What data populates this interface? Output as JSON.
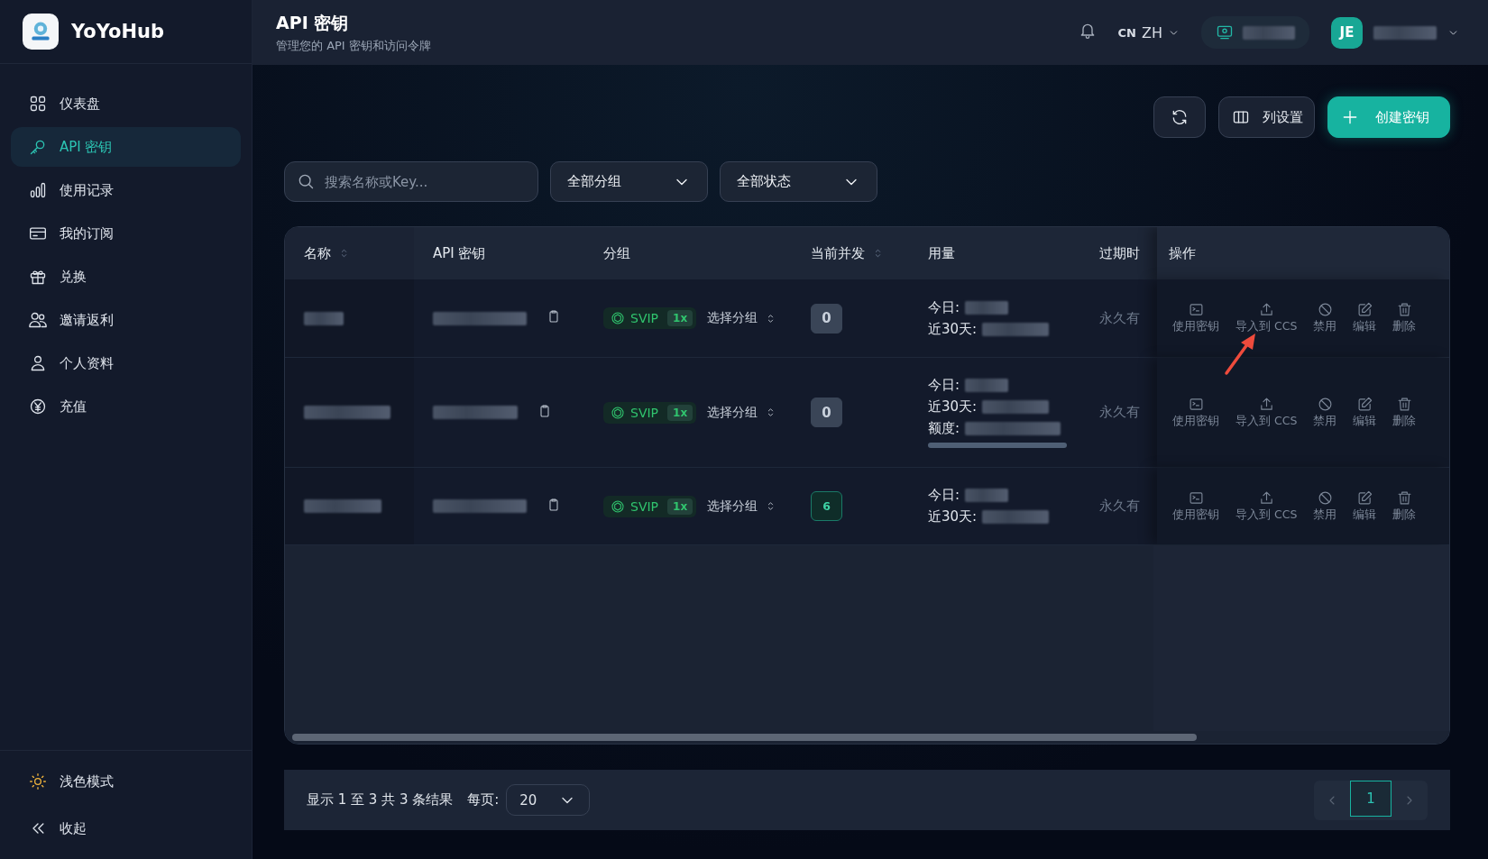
{
  "brand": {
    "name": "YoYoHub"
  },
  "nav": [
    {
      "label": "仪表盘",
      "selected": false
    },
    {
      "label": "API 密钥",
      "selected": true
    },
    {
      "label": "使用记录",
      "selected": false
    },
    {
      "label": "我的订阅",
      "selected": false
    },
    {
      "label": "兑换",
      "selected": false
    },
    {
      "label": "邀请返利",
      "selected": false
    },
    {
      "label": "个人资料",
      "selected": false
    },
    {
      "label": "充值",
      "selected": false
    }
  ],
  "sidebar_footer": [
    {
      "label": "浅色模式"
    },
    {
      "label": "收起"
    }
  ],
  "header": {
    "title": "API 密钥",
    "subtitle": "管理您的 API 密钥和访问令牌",
    "language": {
      "region": "CN",
      "code": "ZH"
    },
    "avatar": "JE"
  },
  "toolbar": [
    {
      "kind": "refresh"
    },
    {
      "kind": "columns",
      "label": "列设置"
    },
    {
      "kind": "create",
      "label": "创建密钥"
    }
  ],
  "filters": {
    "search": {
      "placeholder": "搜索名称或Key..."
    },
    "dropdowns": [
      "全部分组",
      "全部状态"
    ]
  },
  "table": {
    "columns": [
      {
        "label": "名称",
        "sortable": true
      },
      {
        "label": "API 密钥",
        "sortable": false
      },
      {
        "label": "分组",
        "sortable": false
      },
      {
        "label": "当前并发",
        "sortable": true
      },
      {
        "label": "用量",
        "sortable": false
      },
      {
        "label": "过期时",
        "sortable": false
      },
      {
        "label": "操作",
        "sortable": false
      }
    ],
    "rows": [
      {
        "group": "SVIP",
        "multiplier": "1x",
        "group_select": "选择分组",
        "concurrency": "0",
        "active": false,
        "usage": [
          "今日:",
          "近30天:"
        ],
        "expiry": "永久有",
        "actions": [
          {
            "kind": "use",
            "label": "使用密钥"
          },
          {
            "kind": "import",
            "label": "导入到 CCS"
          },
          {
            "kind": "disable",
            "label": "禁用"
          },
          {
            "kind": "edit",
            "label": "编辑"
          },
          {
            "kind": "delete",
            "label": "删除"
          }
        ]
      },
      {
        "group": "SVIP",
        "multiplier": "1x",
        "group_select": "选择分组",
        "concurrency": "0",
        "active": false,
        "usage": [
          "今日:",
          "近30天:"
        ],
        "quota": {
          "label": "额度:",
          "level": 0
        },
        "expiry": "永久有",
        "actions": [
          {
            "kind": "use",
            "label": "使用密钥"
          },
          {
            "kind": "import",
            "label": "导入到 CCS"
          },
          {
            "kind": "disable",
            "label": "禁用"
          },
          {
            "kind": "edit",
            "label": "编辑"
          },
          {
            "kind": "delete",
            "label": "删除"
          }
        ]
      },
      {
        "group": "SVIP",
        "multiplier": "1x",
        "group_select": "选择分组",
        "concurrency": "6",
        "active": true,
        "usage": [
          "今日:",
          "近30天:"
        ],
        "expiry": "永久有",
        "actions": [
          {
            "kind": "use",
            "label": "使用密钥"
          },
          {
            "kind": "import",
            "label": "导入到 CCS"
          },
          {
            "kind": "disable",
            "label": "禁用"
          },
          {
            "kind": "edit",
            "label": "编辑"
          },
          {
            "kind": "delete",
            "label": "删除"
          }
        ]
      }
    ]
  },
  "pagination": {
    "summary": "显示 1 至 3 共 3 条结果",
    "per_page_label": "每页:",
    "per_page": "20",
    "pages": [
      {
        "label": "1",
        "selected": true
      }
    ]
  }
}
